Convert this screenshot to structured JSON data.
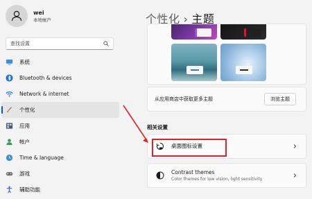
{
  "user": {
    "name": "wei",
    "account_type": "本地帐户"
  },
  "search": {
    "placeholder": "查找设置"
  },
  "nav": [
    {
      "label": "系统",
      "icon": "monitor-icon"
    },
    {
      "label": "Bluetooth & devices",
      "icon": "bluetooth-icon"
    },
    {
      "label": "Network & internet",
      "icon": "wifi-icon"
    },
    {
      "label": "个性化",
      "icon": "brush-icon",
      "active": true
    },
    {
      "label": "应用",
      "icon": "apps-icon"
    },
    {
      "label": "帐户",
      "icon": "person-icon"
    },
    {
      "label": "Time & language",
      "icon": "globe-clock-icon"
    },
    {
      "label": "游戏",
      "icon": "gamepad-icon"
    },
    {
      "label": "辅助功能",
      "icon": "accessibility-icon"
    }
  ],
  "header": {
    "crumb": "个性化",
    "separator": "›",
    "title": "主题"
  },
  "store": {
    "text": "从应用商店中获取更多主题",
    "button": "浏览主题"
  },
  "related": {
    "title": "相关设置",
    "desktop_icons": {
      "label": "桌面图标设置"
    },
    "contrast": {
      "label": "Contrast themes",
      "sub": "Color themes for low vision, light sensitivity"
    }
  },
  "colors": {
    "accent": "#005fb8",
    "annotation": "#e0202a"
  }
}
